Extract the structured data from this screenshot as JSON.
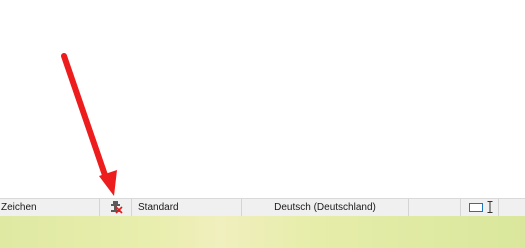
{
  "statusbar": {
    "character_count_label": "Zeichen",
    "signature_icon": "digital-signature-icon",
    "page_style": "Standard",
    "language": "Deutsch (Deutschland)",
    "selection_mode_icon": "standard-selection-icon",
    "insert_mode_icon": "text-cursor-icon"
  },
  "annotation": {
    "arrow_color": "#ee1d1d"
  },
  "colors": {
    "statusbar_bg": "#f0f0f0",
    "taskbar_bg": "#e6eda9"
  }
}
